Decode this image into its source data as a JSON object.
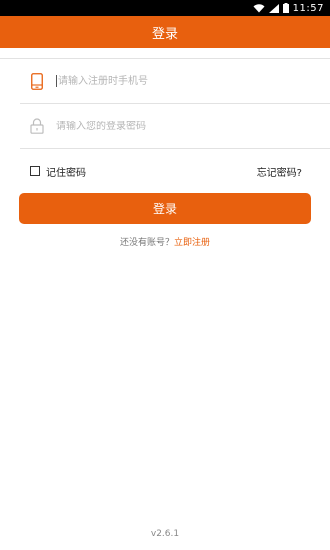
{
  "status_bar": {
    "time": "11:57",
    "icons": [
      "wifi-icon",
      "signal-icon",
      "battery-icon"
    ]
  },
  "header": {
    "title": "登录"
  },
  "form": {
    "phone": {
      "icon": "phone-icon",
      "placeholder": "请输入注册时手机号",
      "value": ""
    },
    "password": {
      "icon": "lock-icon",
      "placeholder": "请输入您的登录密码",
      "value": ""
    }
  },
  "options": {
    "remember_label": "记住密码",
    "remember_checked": false,
    "forgot_label": "忘记密码?"
  },
  "login_button_label": "登录",
  "register": {
    "prompt": "还没有账号？",
    "link_label": "立即注册"
  },
  "version": "v2.6.1",
  "colors": {
    "accent": "#E8600E",
    "divider": "#e2e2e2",
    "status_bar": "#000000"
  }
}
